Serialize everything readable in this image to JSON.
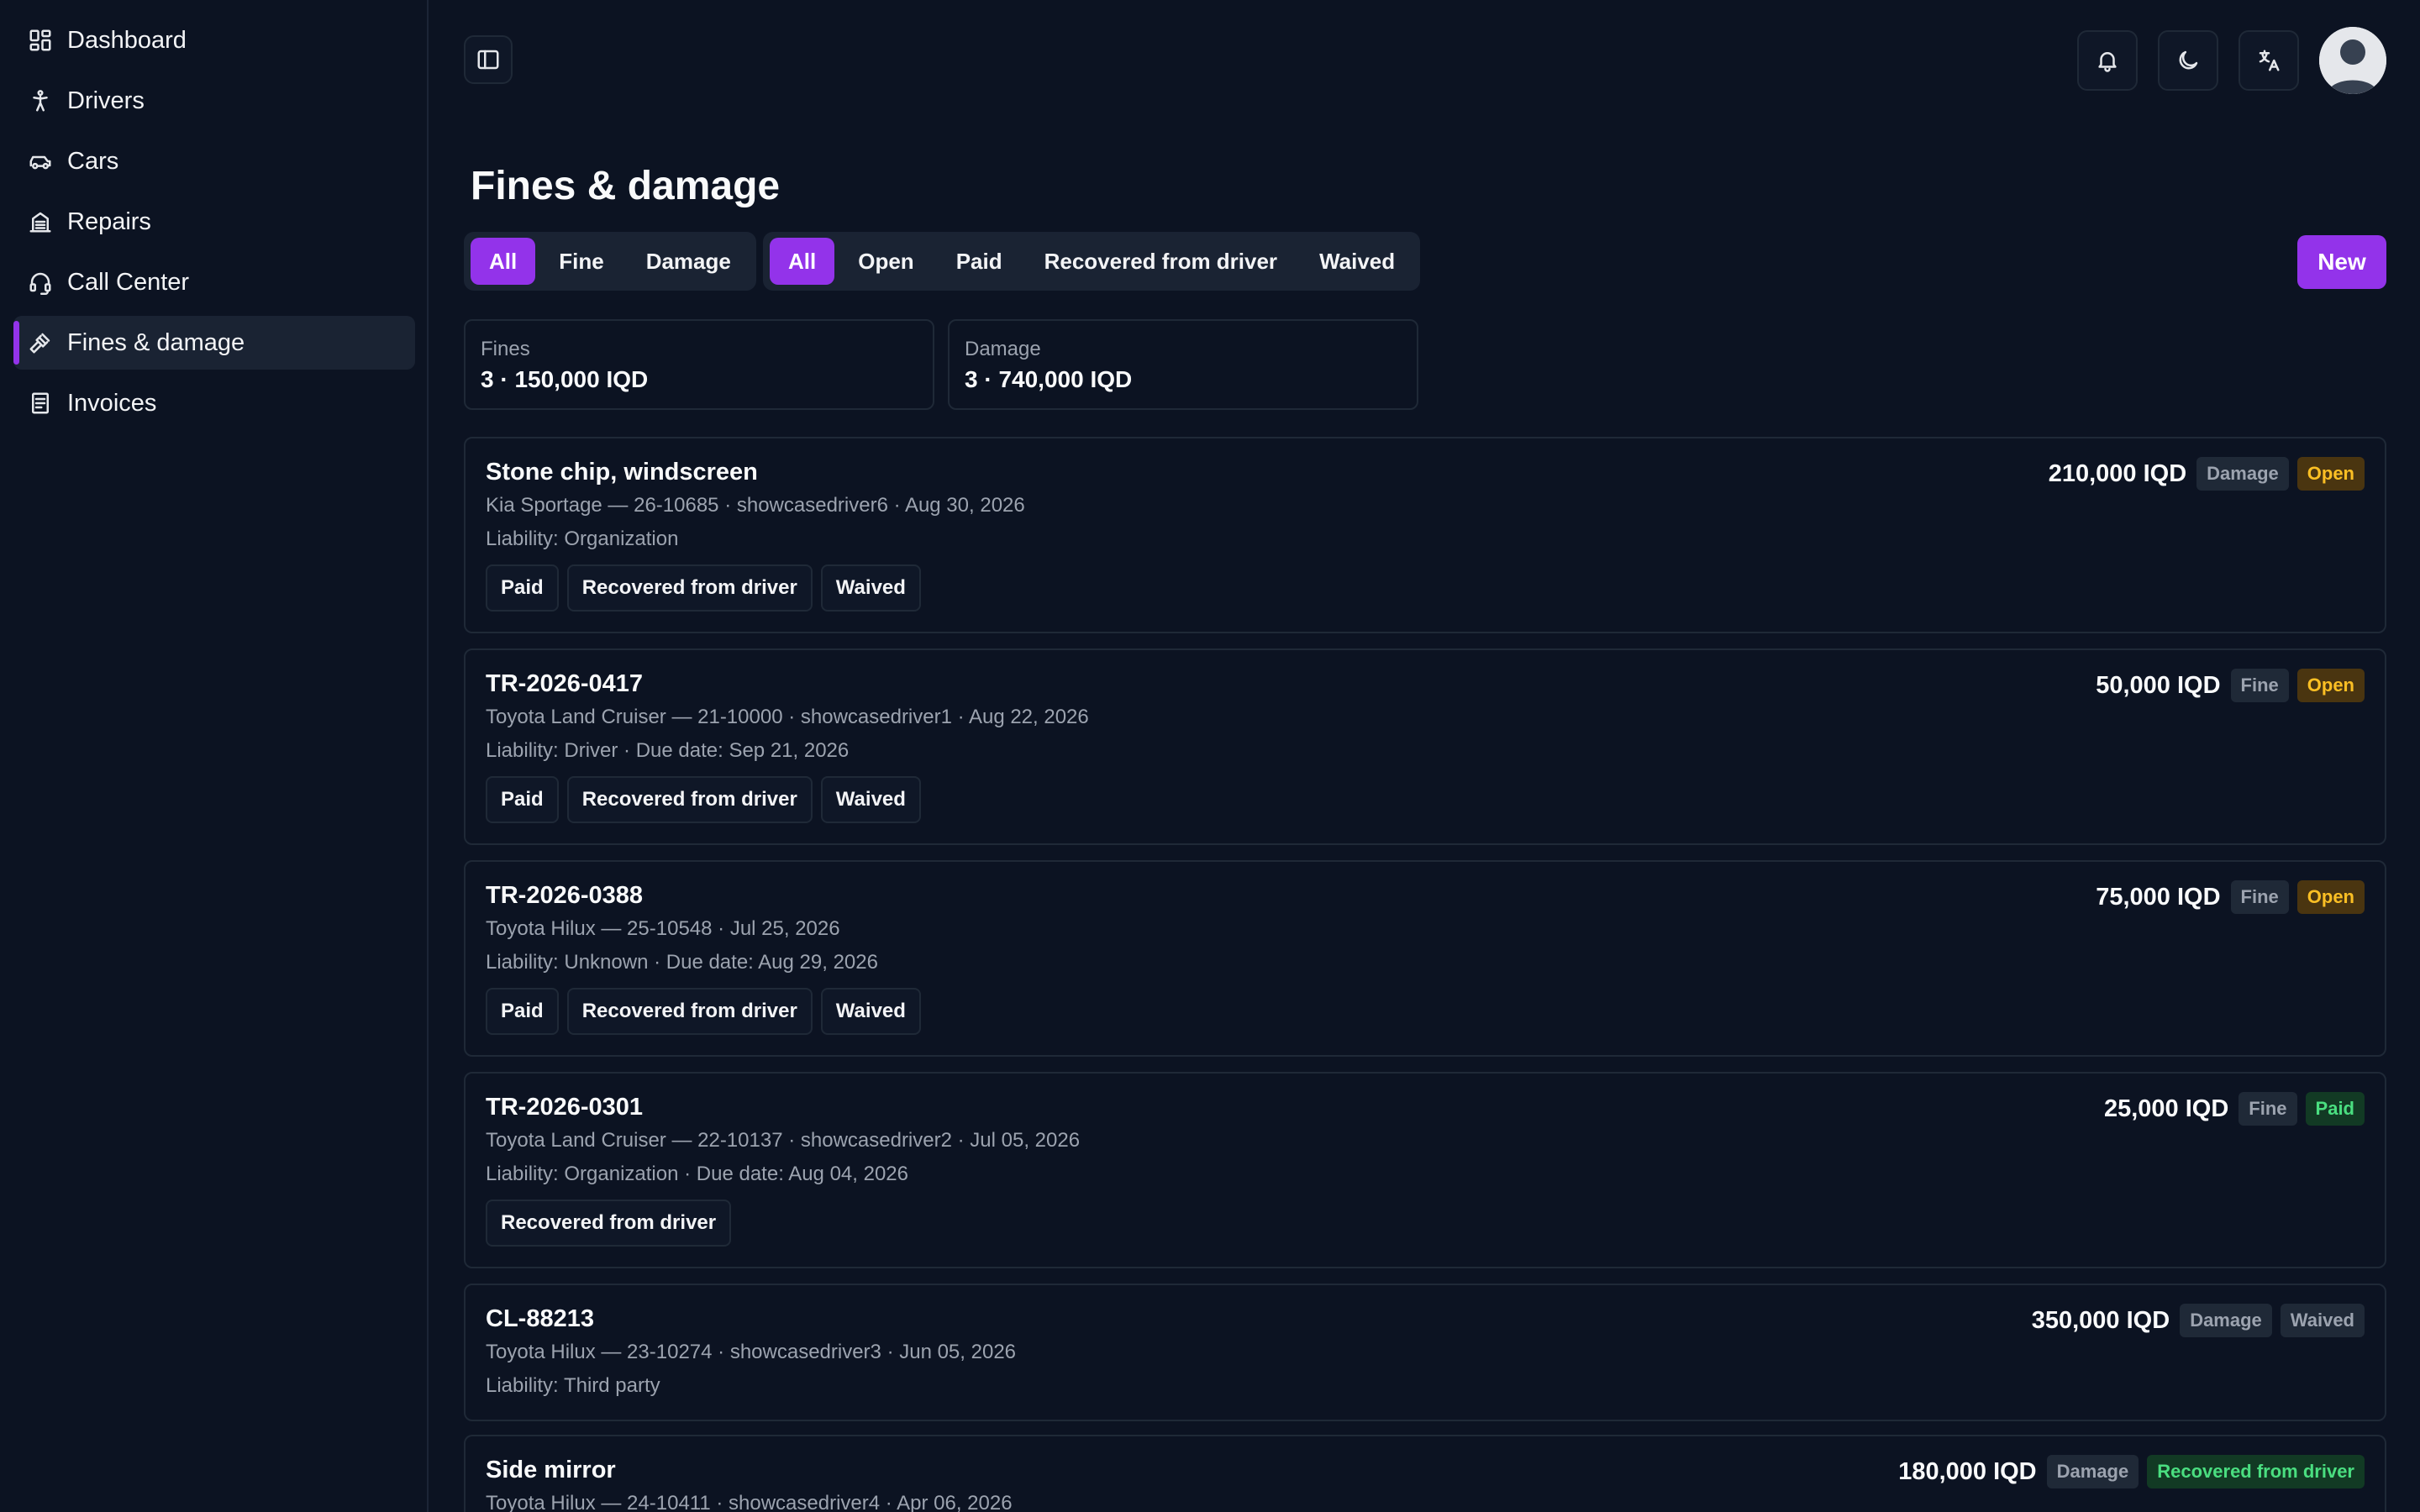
{
  "sidebar": {
    "items": [
      {
        "label": "Dashboard",
        "icon": "dashboard-icon"
      },
      {
        "label": "Drivers",
        "icon": "person-icon"
      },
      {
        "label": "Cars",
        "icon": "car-icon"
      },
      {
        "label": "Repairs",
        "icon": "repair-icon"
      },
      {
        "label": "Call Center",
        "icon": "headset-icon"
      },
      {
        "label": "Fines & damage",
        "icon": "gavel-icon",
        "active": true
      },
      {
        "label": "Invoices",
        "icon": "invoice-icon"
      }
    ]
  },
  "header": {
    "title": "Fines & damage",
    "new_label": "New"
  },
  "filters": {
    "type": [
      "All",
      "Fine",
      "Damage"
    ],
    "type_active": "All",
    "status": [
      "All",
      "Open",
      "Paid",
      "Recovered from driver",
      "Waived"
    ],
    "status_active": "All"
  },
  "summary": {
    "fines": {
      "label": "Fines",
      "value": "3 · 150,000 IQD"
    },
    "damage": {
      "label": "Damage",
      "value": "3 · 740,000 IQD"
    }
  },
  "records": [
    {
      "title": "Stone chip, windscreen",
      "sub": "Kia Sportage — 26-10685 · showcasedriver6 · Aug 30, 2026",
      "liability": "Liability: Organization",
      "amount": "210,000 IQD",
      "type": "Damage",
      "status": "Open",
      "actions": [
        "Paid",
        "Recovered from driver",
        "Waived"
      ]
    },
    {
      "title": "TR-2026-0417",
      "sub": "Toyota Land Cruiser — 21-10000 · showcasedriver1 · Aug 22, 2026",
      "liability": "Liability: Driver · Due date: Sep 21, 2026",
      "amount": "50,000 IQD",
      "type": "Fine",
      "status": "Open",
      "actions": [
        "Paid",
        "Recovered from driver",
        "Waived"
      ]
    },
    {
      "title": "TR-2026-0388",
      "sub": "Toyota Hilux — 25-10548 · Jul 25, 2026",
      "liability": "Liability: Unknown · Due date: Aug 29, 2026",
      "amount": "75,000 IQD",
      "type": "Fine",
      "status": "Open",
      "actions": [
        "Paid",
        "Recovered from driver",
        "Waived"
      ]
    },
    {
      "title": "TR-2026-0301",
      "sub": "Toyota Land Cruiser — 22-10137 · showcasedriver2 · Jul 05, 2026",
      "liability": "Liability: Organization · Due date: Aug 04, 2026",
      "amount": "25,000 IQD",
      "type": "Fine",
      "status": "Paid",
      "actions": [
        "Recovered from driver"
      ]
    },
    {
      "title": "CL-88213",
      "sub": "Toyota Hilux — 23-10274 · showcasedriver3 · Jun 05, 2026",
      "liability": "Liability: Third party",
      "amount": "350,000 IQD",
      "type": "Damage",
      "status": "Waived",
      "actions": []
    },
    {
      "title": "Side mirror",
      "sub": "Toyota Hilux — 24-10411 · showcasedriver4 · Apr 06, 2026",
      "liability": "",
      "amount": "180,000 IQD",
      "type": "Damage",
      "status": "Recovered from driver",
      "actions": []
    }
  ],
  "colors": {
    "background": "#0c1322",
    "accent": "#9333ea",
    "open_status": "#fbbf24",
    "paid_status": "#4ade80"
  }
}
